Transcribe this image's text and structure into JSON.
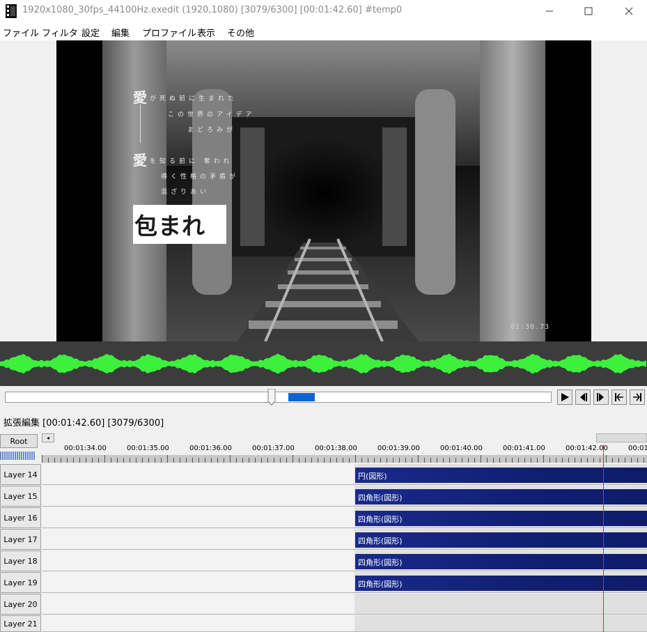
{
  "window": {
    "title": "1920x1080_30fps_44100Hz.exedit (1920,1080)  [3079/6300] [00:01:42.60]  #temp0"
  },
  "menu": {
    "items": [
      "ファイル",
      "フィルタ",
      "設定",
      "編集",
      "プロファイル",
      "表示",
      "その他"
    ]
  },
  "preview": {
    "lyrics": {
      "glyph1": "愛",
      "line1": "が死ぬ前に生まれた",
      "line2": "この世界のアイデア",
      "line3": "まどろみが",
      "glyph2": "愛",
      "line4": "を知る前に 奪われ",
      "line5": "導く性格の矛盾が",
      "line6": "混ざりあい",
      "box_text": "包まれ"
    },
    "timecode": "01:30.73"
  },
  "ext_editor": {
    "title": "拡張編集 [00:01:42.60] [3079/6300]",
    "root_label": "Root",
    "scroll_left": "◂"
  },
  "ruler": {
    "labels": [
      "00:01:34.00",
      "00:01:35.00",
      "00:01:36.00",
      "00:01:37.00",
      "00:01:38.00",
      "00:01:39.00",
      "00:01:40.00",
      "00:01:41.00",
      "00:01:42.00",
      "00:01"
    ]
  },
  "layers": [
    {
      "name": "Layer 14",
      "clip": "円(図形)"
    },
    {
      "name": "Layer 15",
      "clip": "四角形(図形)"
    },
    {
      "name": "Layer 16",
      "clip": "四角形(図形)"
    },
    {
      "name": "Layer 17",
      "clip": "四角形(図形)"
    },
    {
      "name": "Layer 18",
      "clip": "四角形(図形)"
    },
    {
      "name": "Layer 19",
      "clip": "四角形(図形)"
    },
    {
      "name": "Layer 20",
      "clip": ""
    },
    {
      "name": "Layer 21",
      "clip": ""
    }
  ],
  "colors": {
    "waveform": "#3cf03c",
    "clip": "#12207a",
    "playhead": "#d03030",
    "seek_range": "#0a64d2"
  }
}
